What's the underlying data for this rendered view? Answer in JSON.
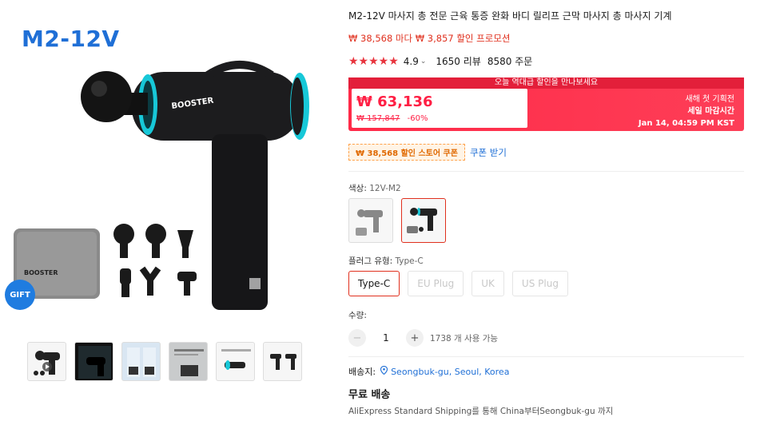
{
  "gallery": {
    "model_title": "M2-12V",
    "gift_badge": "GIFT",
    "brand_text": "BOOSTER",
    "thumbnails": [
      {
        "name": "thumb-kit"
      },
      {
        "name": "thumb-dark"
      },
      {
        "name": "thumb-manual"
      },
      {
        "name": "thumb-specs"
      },
      {
        "name": "thumb-blue-gun"
      },
      {
        "name": "thumb-comparison"
      }
    ]
  },
  "product": {
    "title": "M2-12V 마사지 총 전문 근육 통증 완화 바디 릴리프 근막 마사지 총 마사지 기계",
    "promo": "₩ 38,568 마다 ₩ 3,857 할인 프로모션",
    "rating": "4.9",
    "rating_caret": "⌄",
    "reviews": "1650 리뷰",
    "orders": "8580 주문",
    "stars": "★★★★★"
  },
  "deal": {
    "banner": "오늘 역대급 할인을 만나보세요",
    "price": "₩ 63,136",
    "original_price": "₩ 157,847",
    "discount": "-60%",
    "right_line1": "새해 첫 기획전",
    "right_line2": "세일 마감시간",
    "right_line3": "Jan 14, 04:59 PM KST"
  },
  "coupon": {
    "tag": "₩ 38,568 할인 스토어 쿠폰",
    "link": "쿠폰 받기"
  },
  "color": {
    "label": "색상: ",
    "value": "12V-M2"
  },
  "plug": {
    "label": "플러그 유형: ",
    "value": "Type-C",
    "options": [
      "Type-C",
      "EU Plug",
      "UK",
      "US Plug"
    ]
  },
  "quantity": {
    "label": "수량:",
    "minus": "−",
    "value": "1",
    "plus": "+",
    "available": "1738 개 사용 가능"
  },
  "shipping": {
    "label": "배송지:",
    "location": "Seongbuk-gu, Seoul, Korea",
    "free": "무료 배송",
    "desc": "AliExpress Standard Shipping를 통해 China부터Seongbuk-gu 까지"
  },
  "colors": {
    "accent_red": "#e0301e",
    "deal_red": "#ff2a48",
    "link_blue": "#1f6fd6",
    "star_red": "#e8343d",
    "brand_cyan": "#17c8d8"
  }
}
